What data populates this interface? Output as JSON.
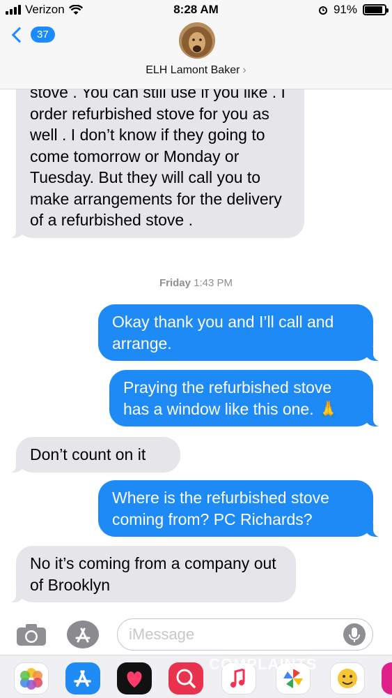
{
  "status_bar": {
    "carrier": "Verizon",
    "time": "8:28 AM",
    "battery": "91%",
    "battery_level": 0.91
  },
  "header": {
    "back_count": "37",
    "contact_name": "ELH Lamont Baker"
  },
  "messages": [
    {
      "direction": "in",
      "text": "stove . You can still use if you like . I order refurbished stove for you as well . I don’t know if they going to come tomorrow or Monday or Tuesday. But they will call you to make arrangements for the delivery of a refurbished stove ."
    },
    {
      "direction": "out",
      "text": "Okay thank you and I’ll call and arrange."
    },
    {
      "direction": "out",
      "text": "Praying the refurbished stove has a window like this one. 🙏"
    },
    {
      "direction": "in",
      "text": "Don’t count on it"
    },
    {
      "direction": "out",
      "text": "Where is the refurbished stove coming from? PC Richards?"
    },
    {
      "direction": "in",
      "text": "No it’s coming from a company out of Brooklyn"
    }
  ],
  "timestamp": {
    "day": "Friday",
    "time": "1:43 PM"
  },
  "input": {
    "placeholder": "iMessage"
  },
  "watermark": "COMPLAINTS",
  "icons": [
    "camera-icon",
    "app-store-icon",
    "microphone-icon",
    "photos-app-icon",
    "app-store-app-icon",
    "heart-app-icon",
    "search-app-icon",
    "music-app-icon",
    "maps-app-icon",
    "emoji-app-icon"
  ]
}
